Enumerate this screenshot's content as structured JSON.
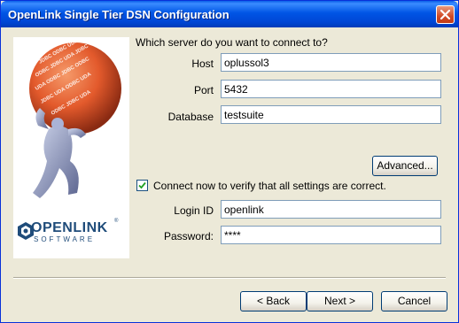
{
  "window": {
    "title": "OpenLink Single Tier DSN Configuration"
  },
  "logo": {
    "brand_name": "OPENLINK",
    "brand_sub": "SOFTWARE",
    "tm": "®"
  },
  "form": {
    "prompt": "Which server do you want to connect to?",
    "host_label": "Host",
    "host_value": "oplussol3",
    "port_label": "Port",
    "port_value": "5432",
    "database_label": "Database",
    "database_value": "testsuite",
    "advanced_label": "Advanced...",
    "connect_checked": true,
    "connect_label": "Connect now to verify that all settings are correct.",
    "login_label": "Login ID",
    "login_value": "openlink",
    "password_label": "Password:",
    "password_value": "****"
  },
  "buttons": {
    "back": "< Back",
    "next": "Next >",
    "cancel": "Cancel"
  },
  "colors": {
    "titlebar": "#0055e5",
    "window_bg": "#ece9d8",
    "sphere": "#e35a2c",
    "brand": "#1f4c7a"
  }
}
